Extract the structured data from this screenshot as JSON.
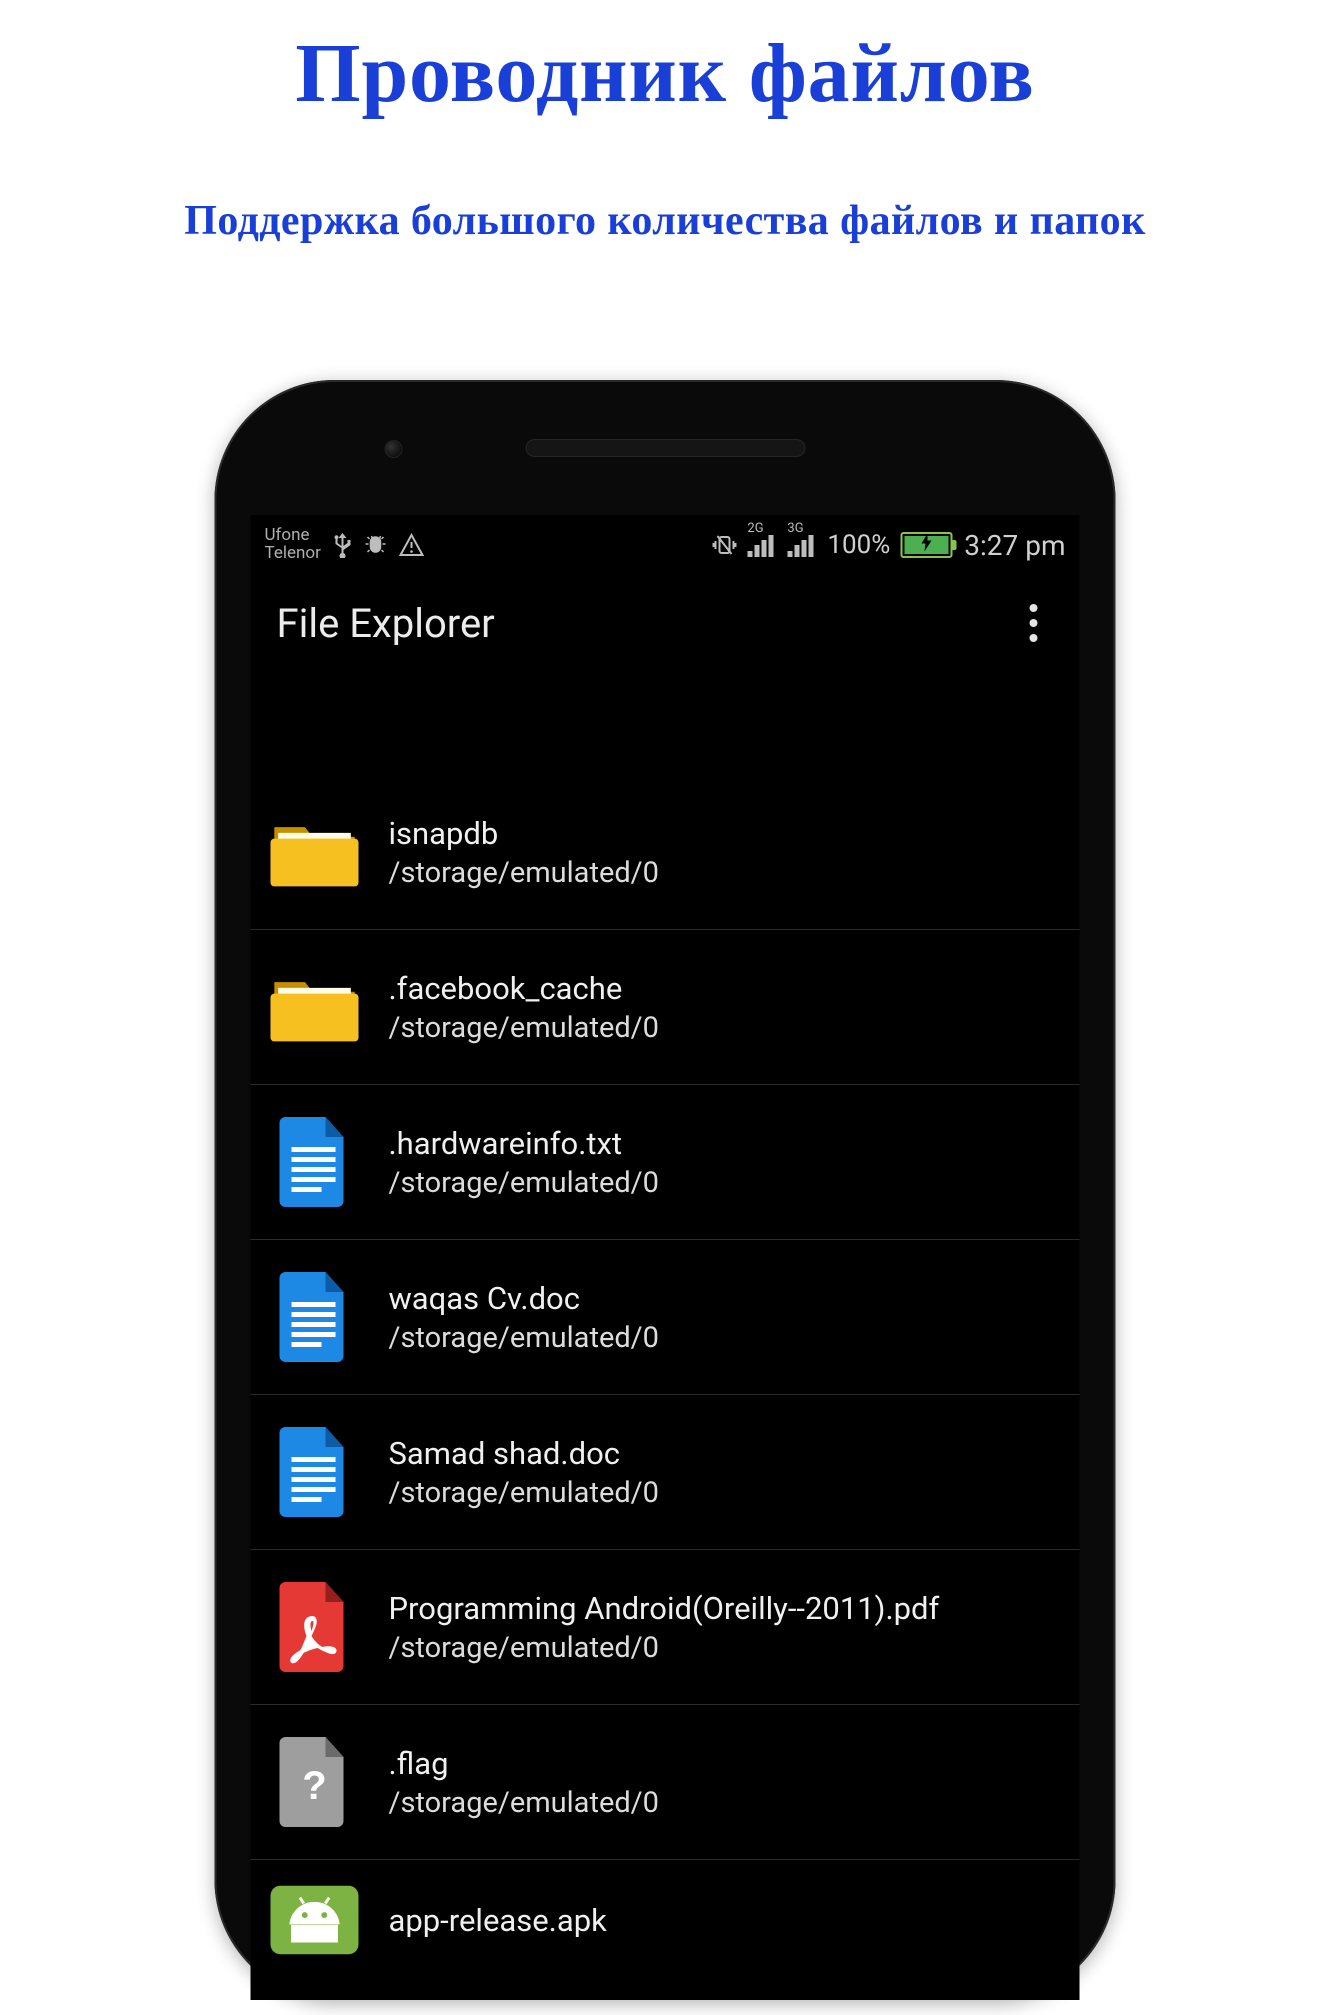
{
  "page": {
    "title": "Проводник файлов",
    "subtitle": "Поддержка большого количества файлов и папок"
  },
  "statusbar": {
    "carrier1": "Ufone",
    "carrier2": "Telenor",
    "signal1_label": "2G",
    "signal2_label": "3G",
    "battery_percent": "100%",
    "time": "3:27 pm"
  },
  "appbar": {
    "title": "File Explorer"
  },
  "files": [
    {
      "name": "isnapdb",
      "path": "/storage/emulated/0"
    },
    {
      "name": ".facebook_cache",
      "path": "/storage/emulated/0"
    },
    {
      "name": ".hardwareinfo.txt",
      "path": "/storage/emulated/0"
    },
    {
      "name": "waqas Cv.doc",
      "path": "/storage/emulated/0"
    },
    {
      "name": "Samad shad.doc",
      "path": "/storage/emulated/0"
    },
    {
      "name": "Programming Android(Oreilly--2011).pdf",
      "path": "/storage/emulated/0"
    },
    {
      "name": ".flag",
      "path": "/storage/emulated/0"
    },
    {
      "name": "app-release.apk",
      "path": ""
    }
  ],
  "colors": {
    "accent": "#1a3fd6",
    "folder": "#f6c021",
    "doc": "#1e88e5",
    "pdf": "#e53935",
    "apk": "#7cb342",
    "unknown": "#9e9e9e"
  }
}
